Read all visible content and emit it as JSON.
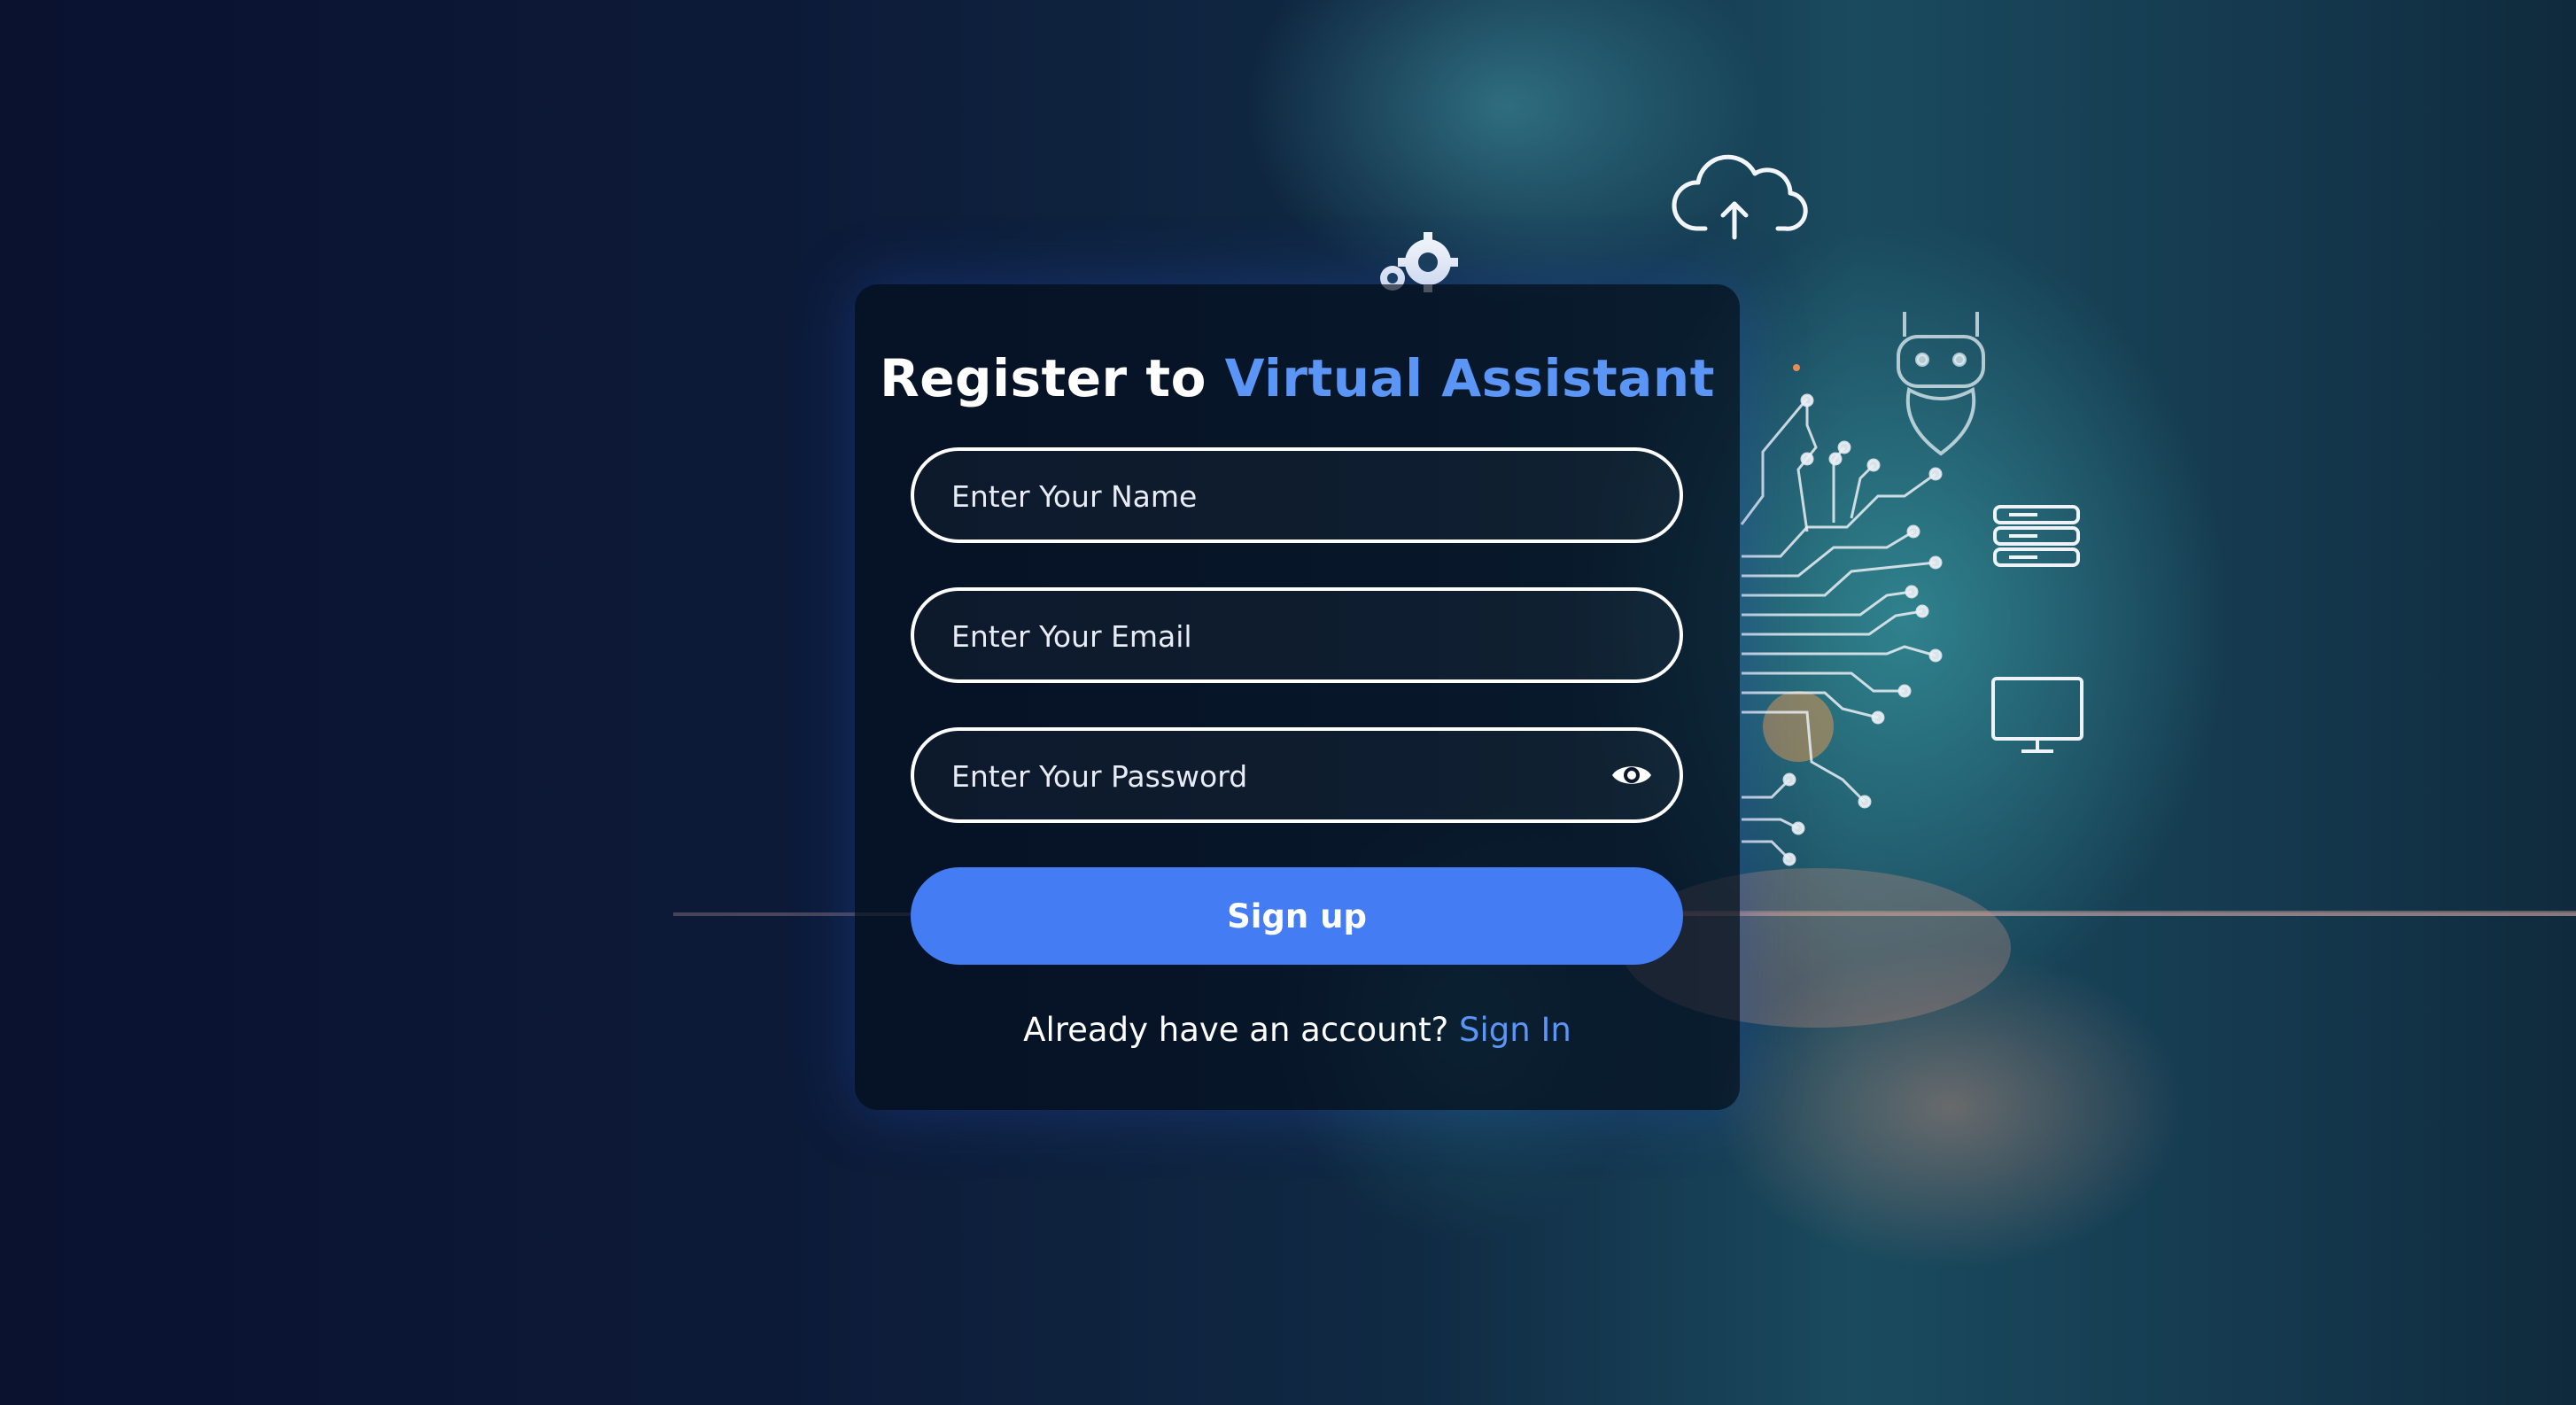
{
  "form": {
    "title_prefix": "Register to",
    "title_accent": "Virtual Assistant",
    "name_placeholder": "Enter Your Name",
    "email_placeholder": "Enter Your Email",
    "password_placeholder": "Enter Your Password",
    "password_toggle_icon": "eye-icon",
    "submit_label": "Sign up",
    "footer_text": "Already have an account?",
    "footer_link": "Sign In"
  },
  "background_icons": [
    "gear-icon",
    "cloud-upload-icon",
    "robot-icon",
    "server-icon",
    "monitor-icon",
    "circuit-icon"
  ],
  "colors": {
    "accent": "#5b95f5",
    "button": "#437cf3",
    "card": "#040e1e",
    "text": "#ffffff"
  }
}
